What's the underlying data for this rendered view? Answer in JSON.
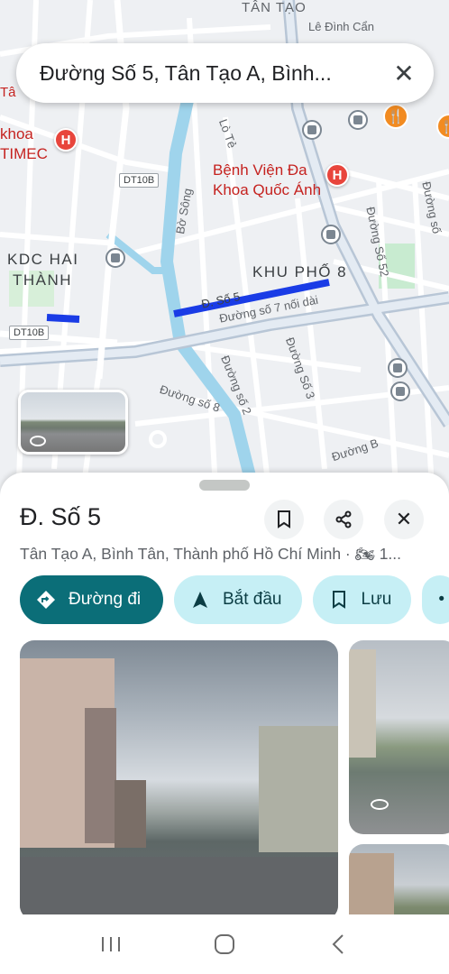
{
  "search": {
    "query": "Đường Số 5, Tân Tạo A, Bình..."
  },
  "map": {
    "labels": {
      "tan_tao": "TÂN TẠO",
      "le_dinh_can": "Lê Đình Cẩn",
      "khoa": "khoa",
      "timec": "TIMEC",
      "tan_frag": "Tâ",
      "hospital_name_1": "Bệnh Viện Đa",
      "hospital_name_2": "Khoa Quốc Ánh",
      "lo_te": "Lò Tẻ",
      "bo_song": "Bờ Sông",
      "kdc_1": "KDC HAI",
      "kdc_2": "THÀNH",
      "khu_pho": "KHU PHỐ 8",
      "d_so5": "Đ. Số 5",
      "duong_so7": "Đường số 7 nối dài",
      "duong_so52": "Đường Số 52",
      "duong_so8": "Đường số 8",
      "duong_so2": "Đường số 2",
      "duong_so3": "Đường Số 3",
      "duong_b": "Đường B",
      "duong_so_right": "Đường số"
    },
    "road_tags": {
      "dt10b_top": "DT10B",
      "dt10b_left": "DT10B"
    }
  },
  "place": {
    "title": "Đ. Số 5",
    "address": "Tân Tạo A, Bình Tân, Thành phố Hồ Chí Minh · 🏍 1..."
  },
  "chips": {
    "directions": "Đường đi",
    "start": "Bắt đầu",
    "save": "Lưu"
  }
}
